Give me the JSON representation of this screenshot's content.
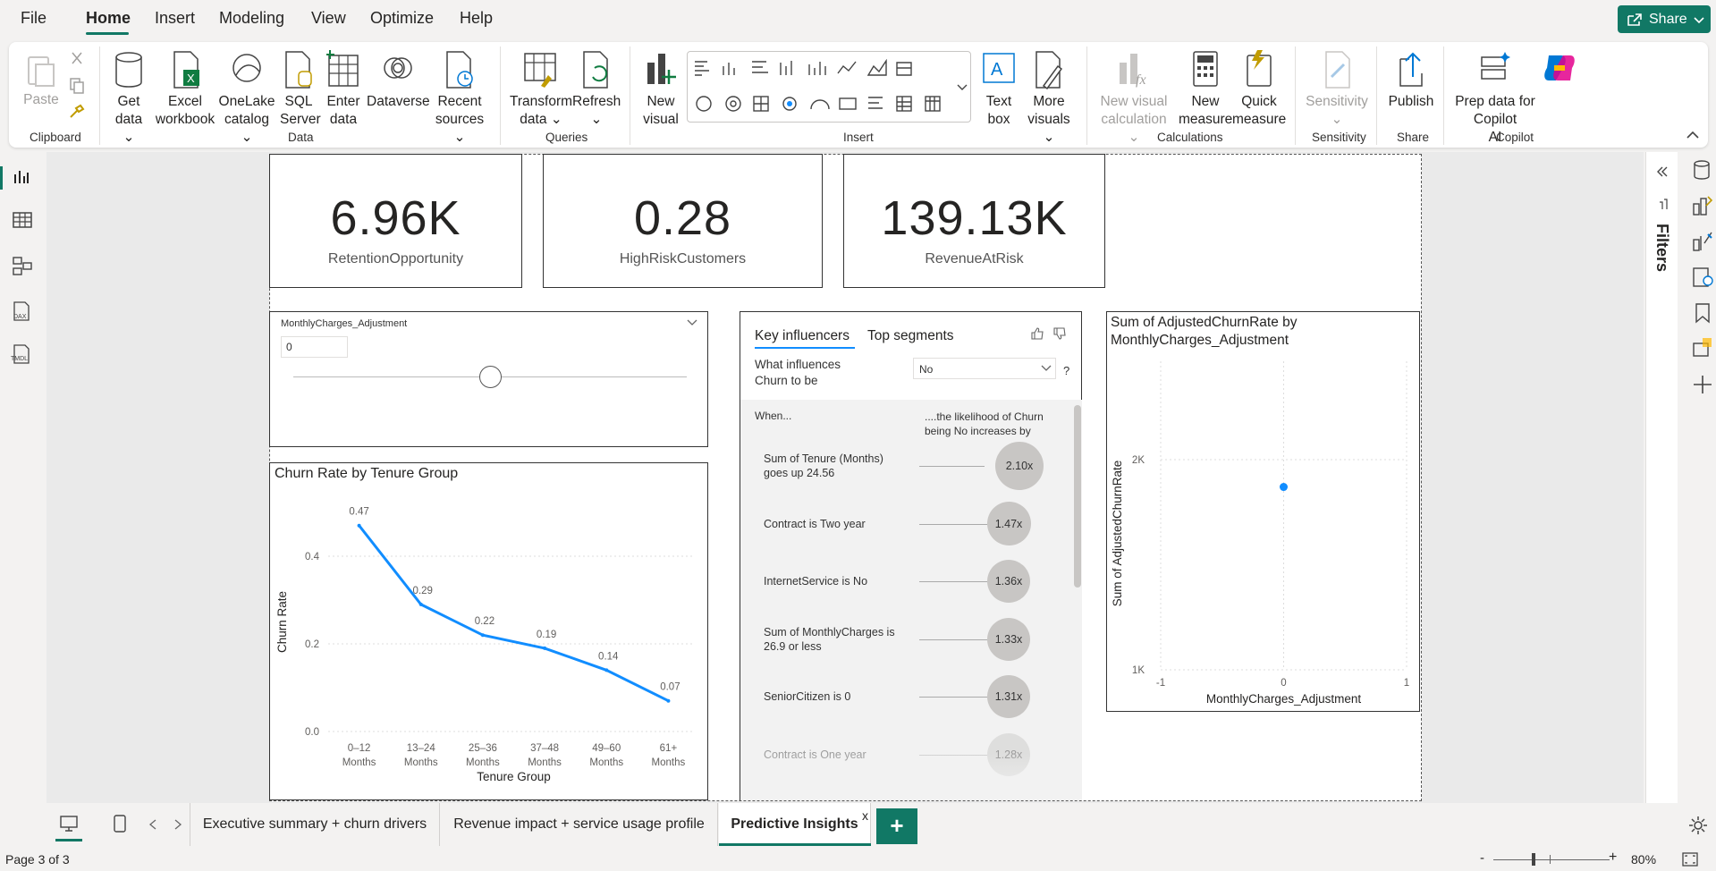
{
  "menu": {
    "file": "File",
    "home": "Home",
    "insert": "Insert",
    "modeling": "Modeling",
    "view": "View",
    "optimize": "Optimize",
    "help": "Help",
    "share": "Share"
  },
  "ribbon": {
    "paste": "Paste",
    "clipboard": "Clipboard",
    "get_data_1": "Get",
    "get_data_2": "data",
    "excel_1": "Excel",
    "excel_2": "workbook",
    "onelake_1": "OneLake",
    "onelake_2": "catalog",
    "sql_1": "SQL",
    "sql_2": "Server",
    "enter_1": "Enter",
    "enter_2": "data",
    "dataverse": "Dataverse",
    "recent_1": "Recent",
    "recent_2": "sources",
    "data_group": "Data",
    "transform_1": "Transform",
    "transform_2": "data",
    "refresh": "Refresh",
    "queries_group": "Queries",
    "new_visual_1": "New",
    "new_visual_2": "visual",
    "text_box_1": "Text",
    "text_box_2": "box",
    "more_visuals_1": "More",
    "more_visuals_2": "visuals",
    "insert_group": "Insert",
    "new_visual_calc_1": "New visual",
    "new_visual_calc_2": "calculation",
    "new_measure_1": "New",
    "new_measure_2": "measure",
    "quick_measure_1": "Quick",
    "quick_measure_2": "measure",
    "calculations_group": "Calculations",
    "sensitivity": "Sensitivity",
    "sensitivity_group": "Sensitivity",
    "publish": "Publish",
    "share_group": "Share",
    "prep_1": "Prep data for Copilot",
    "prep_2": "AI",
    "copilot": "Copilot"
  },
  "kpis": [
    {
      "value": "6.96K",
      "label": "RetentionOpportunity"
    },
    {
      "value": "0.28",
      "label": "HighRiskCustomers"
    },
    {
      "value": "139.13K",
      "label": "RevenueAtRisk"
    }
  ],
  "slicer": {
    "title": "MonthlyCharges_Adjustment",
    "value": "0",
    "level": 0.5
  },
  "churn_chart": {
    "title": "Churn Rate by Tenure Group",
    "chart_data": {
      "type": "line",
      "title": "Churn Rate by Tenure Group",
      "xlabel": "Tenure Group",
      "ylabel": "Churn Rate",
      "categories": [
        [
          "0–12",
          "Months"
        ],
        [
          "13–24",
          "Months"
        ],
        [
          "25–36",
          "Months"
        ],
        [
          "37–48",
          "Months"
        ],
        [
          "49–60",
          "Months"
        ],
        [
          "61+",
          "Months"
        ]
      ],
      "values": [
        0.47,
        0.29,
        0.22,
        0.19,
        0.14,
        0.07
      ],
      "labels": [
        "0.47",
        "0.29",
        "0.22",
        "0.19",
        "0.14",
        "0.07"
      ],
      "yticks": [
        "0.0",
        "0.2",
        "0.4"
      ],
      "ylim": [
        0,
        0.5
      ],
      "color": "#118dff",
      "grid": true
    }
  },
  "influencers": {
    "tab_key": "Key influencers",
    "tab_top": "Top segments",
    "question": "What influences Churn to be",
    "dropdown": "No",
    "help": "?",
    "when": "When...",
    "likelihood": "....the likelihood of Churn being No increases by",
    "rows": [
      {
        "text": "Sum of Tenure (Months) goes up 24.56",
        "value": "2.10x",
        "size": 2.1
      },
      {
        "text": "Contract is Two year",
        "value": "1.47x",
        "size": 1.47
      },
      {
        "text": "InternetService is No",
        "value": "1.36x",
        "size": 1.36
      },
      {
        "text": "Sum of MonthlyCharges is 26.9 or less",
        "value": "1.33x",
        "size": 1.33
      },
      {
        "text": "SeniorCitizen is 0",
        "value": "1.31x",
        "size": 1.31
      },
      {
        "text": "Contract is One year",
        "value": "1.28x",
        "size": 1.28
      }
    ]
  },
  "scatter": {
    "title": "Sum of AdjustedChurnRate by MonthlyCharges_Adjustment",
    "chart_data": {
      "type": "scatter",
      "title": "Sum of AdjustedChurnRate by MonthlyCharges_Adjustment",
      "xlabel": "MonthlyCharges_Adjustment",
      "ylabel": "Sum of AdjustedChurnRate",
      "xticks": [
        "-1",
        "0",
        "1"
      ],
      "yticks": [
        "1K",
        "2K"
      ],
      "xlim": [
        -1,
        1
      ],
      "ylim": [
        1000,
        2000
      ],
      "points": [
        {
          "x": 0,
          "y": 1870
        }
      ],
      "color": "#118dff"
    }
  },
  "tabs": [
    {
      "label": "Executive summary + churn drivers"
    },
    {
      "label": "Revenue impact + service usage profile"
    },
    {
      "label": "Predictive Insights"
    }
  ],
  "tab_close": "x",
  "tab_add": "+",
  "status": {
    "page": "Page 3 of 3",
    "zoom": "80%",
    "zoom_minus": "-",
    "zoom_plus": "+"
  },
  "filters_label": "Filters",
  "colors": {
    "accent": "#117865",
    "series": "#118dff"
  }
}
